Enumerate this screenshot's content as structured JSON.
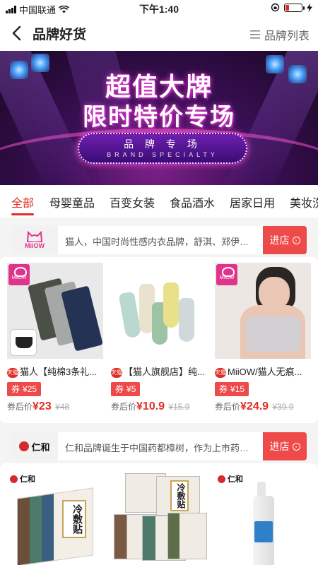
{
  "status": {
    "carrier": "中国联通",
    "time": "下午1:40"
  },
  "nav": {
    "title": "品牌好货",
    "right_label": "品牌列表"
  },
  "banner": {
    "title1": "超值大牌",
    "title2": "限时特价专场",
    "pill_cn": "品 牌 专 场",
    "pill_en": "BRAND SPECIALTY"
  },
  "tabs": [
    "全部",
    "母婴童品",
    "百变女装",
    "食品酒水",
    "居家日用",
    "美妆洗"
  ],
  "stores": [
    {
      "logo_text": "MiiOW",
      "description": "猫人，中国时尚性感内衣品牌，舒淇、郑伊健、...",
      "enter_label": "进店",
      "products": [
        {
          "shop_badge": "天猫",
          "name": "猫人【纯棉3条礼...",
          "coupon_prefix": "券",
          "coupon_value": "¥25",
          "price_prefix": "券后价",
          "price": "¥23",
          "old_price": "¥48"
        },
        {
          "shop_badge": "天猫",
          "name": "【猫人旗舰店】纯...",
          "coupon_prefix": "券",
          "coupon_value": "¥5",
          "price_prefix": "券后价",
          "price": "¥10.9",
          "old_price": "¥15.9"
        },
        {
          "shop_badge": "天猫",
          "name": "MiiOW/猫人无痕...",
          "coupon_prefix": "券",
          "coupon_value": "¥15",
          "price_prefix": "券后价",
          "price": "¥24.9",
          "old_price": "¥39.9"
        }
      ]
    },
    {
      "logo_text": "仁和",
      "description": "仁和品牌诞生于中国药都樟树，作为上市药企,...",
      "enter_label": "进店",
      "product_labels": [
        "冷敷贴",
        "冷敷贴"
      ]
    }
  ],
  "colors": {
    "accent": "#e02e24",
    "button": "#ef4a4a",
    "background": "#f4f4f4"
  }
}
